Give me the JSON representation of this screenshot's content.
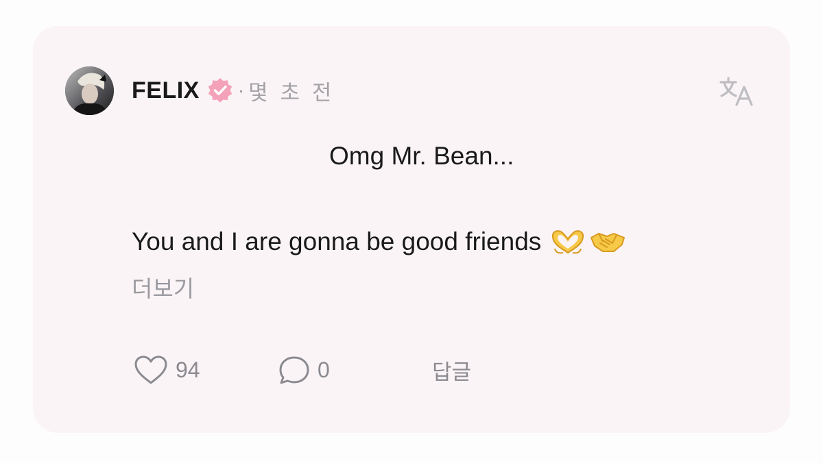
{
  "post": {
    "author": "FELIX",
    "separator": "·",
    "time": "몇 초 전",
    "body_line1": "Omg Mr. Bean...",
    "body_line2": "You and I are gonna be good friends",
    "emojis": [
      "heart-hands",
      "handshake"
    ],
    "more_label": "더보기"
  },
  "actions": {
    "likes": "94",
    "comments": "0",
    "reply_label": "답글"
  },
  "colors": {
    "card_bg": "#fbf4f6",
    "verified_badge": "#f4a1ba",
    "muted_text": "#9a9aa0"
  },
  "icons": [
    "verified-badge-icon",
    "translate-icon",
    "heart-icon",
    "comment-bubble-icon"
  ]
}
